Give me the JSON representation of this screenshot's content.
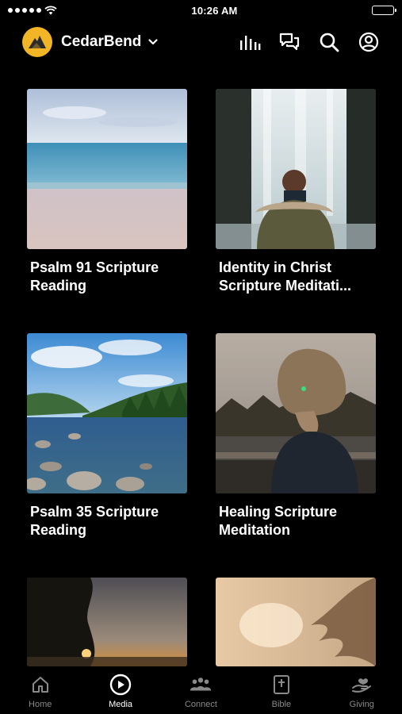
{
  "status": {
    "time": "10:26 AM"
  },
  "header": {
    "church_name": "CedarBend"
  },
  "media_items": [
    {
      "title": "Psalm 91 Scripture Reading"
    },
    {
      "title": "Identity in Christ Scripture Meditati..."
    },
    {
      "title": "Psalm 35 Scripture Reading"
    },
    {
      "title": "Healing Scripture Meditation"
    }
  ],
  "tabs": [
    {
      "label": "Home",
      "icon": "home-icon"
    },
    {
      "label": "Media",
      "icon": "play-circle-icon"
    },
    {
      "label": "Connect",
      "icon": "people-icon"
    },
    {
      "label": "Bible",
      "icon": "bible-icon"
    },
    {
      "label": "Giving",
      "icon": "giving-hand-icon"
    }
  ],
  "colors": {
    "accent": "#f2b526",
    "background": "#000000",
    "inactive_tab": "#8a8a8a"
  }
}
